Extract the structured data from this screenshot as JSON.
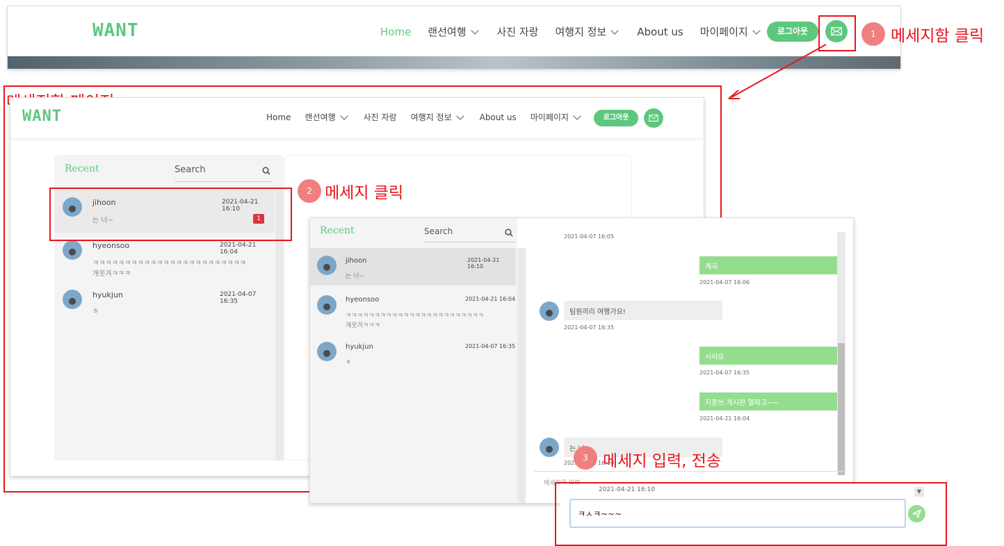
{
  "nav": {
    "logo": "WANT",
    "items": [
      "Home",
      "랜선여행",
      "사진 자랑",
      "여행지 정보",
      "About us",
      "마이페이지"
    ],
    "logout": "로그아웃"
  },
  "annotations": {
    "step1": "1",
    "step1_text": "메세지함 클릭",
    "page_label": "메세지함 페이지",
    "step2": "2",
    "step2_text": "메세지 클릭",
    "step3": "3",
    "step3_text": "메세지 입력, 전송"
  },
  "sidebar": {
    "title": "Recent",
    "search_placeholder": "Search",
    "conversations": [
      {
        "name": "jihoon",
        "date": "2021-04-21 16:10",
        "preview": "는 너~",
        "preview2": "",
        "unread": "1"
      },
      {
        "name": "hyeonsoo",
        "date": "2021-04-21 16:04",
        "preview": "ㅋㅋㅋㅋㅋㅋㅋㅋㅋㅋㅋㅋㅋㅋㅋㅋㅋㅋㅋㅋㅋㅋㅋㅋ",
        "preview2": "개웃겨ㅋㅋㅋ",
        "unread": ""
      },
      {
        "name": "hyukjun",
        "date": "2021-04-07 16:35",
        "preview": "ㅎ",
        "preview2": "",
        "unread": ""
      }
    ]
  },
  "chat": {
    "top_time": "2021-04-07 16:05",
    "messages": [
      {
        "dir": "out",
        "text": "계곡",
        "time": "2021-04-07 16:06"
      },
      {
        "dir": "in",
        "text": "팀원끼리 여행가요!",
        "time": "2021-04-07 16:35"
      },
      {
        "dir": "out",
        "text": "시러요",
        "time": "2021-04-07 16:35"
      },
      {
        "dir": "out",
        "text": "지훈쓰 게시판 열파고~~",
        "time": "2021-04-21 16:04"
      },
      {
        "dir": "in",
        "text": "는 너~",
        "time": "2021-04-21 16:10"
      }
    ],
    "input_placeholder": "메세지를 입력...",
    "last_time": "2021-04-21 16:10",
    "typed": "ㅋㅅㅋ~~~"
  },
  "colors": {
    "accent": "#5ec77e",
    "annotation": "#e8141c",
    "step_circle": "#f07f80",
    "bubble_out": "#94dd8f"
  }
}
